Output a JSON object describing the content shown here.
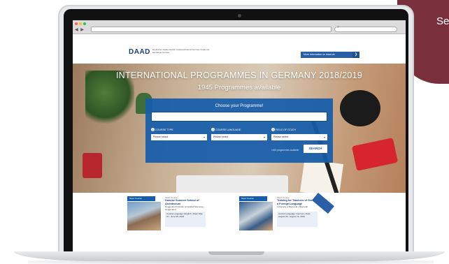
{
  "corner_badge": {
    "text": "Se"
  },
  "browser": {
    "nav_buttons": "◀ ▶",
    "search_icon": "search-icon",
    "traffic_colors": [
      "#ff5f57",
      "#febc2e",
      "#28c840"
    ]
  },
  "header": {
    "logo": "DAAD",
    "logo_subtitle": "Deutscher Akademischer Austauschdienst German Academic Exchange Service",
    "nav_link": "More information on daad.de",
    "nav_arrow": "❯"
  },
  "hero": {
    "title": "INTERNATIONAL PROGRAMMES IN GERMANY 2018/2019",
    "subtitle": "1945 Programmes available"
  },
  "search_panel": {
    "title": "Choose your Programme!",
    "input_placeholder": "",
    "filters": [
      {
        "number": "1",
        "label": "COURSE TYPE",
        "select": "Please select"
      },
      {
        "number": "2",
        "label": "COURSE LANGUAGE",
        "select": "Please select"
      },
      {
        "number": "3",
        "label": "FIELD OF STUDY",
        "select": "Please select"
      }
    ],
    "result_count": "1945 programmes available",
    "button": "SEARCH"
  },
  "cards": [
    {
      "head": "Short Course",
      "category": "Short Course",
      "title": "Danube Summer School of Architecture",
      "institution": "Deggendorf Institute of Applied Sciences • Deggendorf",
      "box": "Course Language: English • Date: May 27 - June 08, 2019"
    },
    {
      "head": "Short Course",
      "category": "Short Course",
      "title": "Training for Teachers of German as a Foreign Language",
      "institution": "University of Bayreuth • Bayreuth",
      "box": "Course Language: German • Date: August 05 - August 16, 2019"
    }
  ],
  "accent_colors": {
    "daad_blue": "#155caa",
    "dark_blue": "#1b3f7a",
    "badge": "#7a2f3d"
  }
}
